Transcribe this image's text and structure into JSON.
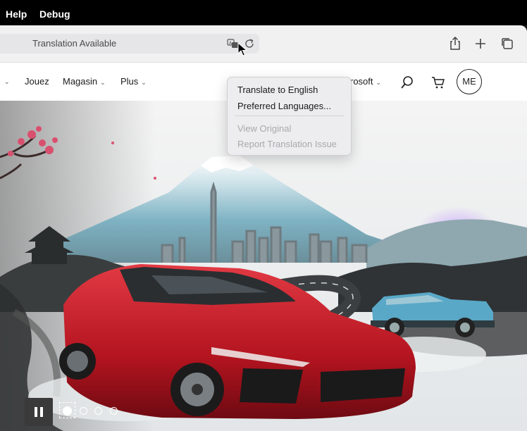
{
  "menubar": {
    "items": [
      "Help",
      "Debug"
    ]
  },
  "toolbar": {
    "address_text": "Translation Available",
    "icons": [
      "translate-icon",
      "reload-icon",
      "share-icon",
      "new-tab-icon",
      "tab-overview-icon"
    ]
  },
  "site_nav": {
    "items": [
      {
        "label": "Jouez",
        "has_chevron": false
      },
      {
        "label": "Magasin",
        "has_chevron": true
      },
      {
        "label": "Plus",
        "has_chevron": true
      },
      {
        "label": "rosoft",
        "has_chevron": true
      }
    ],
    "avatar_initials": "ME"
  },
  "translate_menu": {
    "items": [
      {
        "label": "Translate to English",
        "enabled": true
      },
      {
        "label": "Preferred Languages...",
        "enabled": true
      },
      {
        "label": "View Original",
        "enabled": false
      },
      {
        "label": "Report Translation Issue",
        "enabled": false
      }
    ]
  },
  "carousel": {
    "slide_count": 4,
    "current_slide": 1,
    "paused": false
  },
  "colors": {
    "menubar_bg": "#000000",
    "car_red": "#c8202b",
    "suv_blue": "#5aa8c8",
    "disabled_text": "#a9a9ad"
  }
}
